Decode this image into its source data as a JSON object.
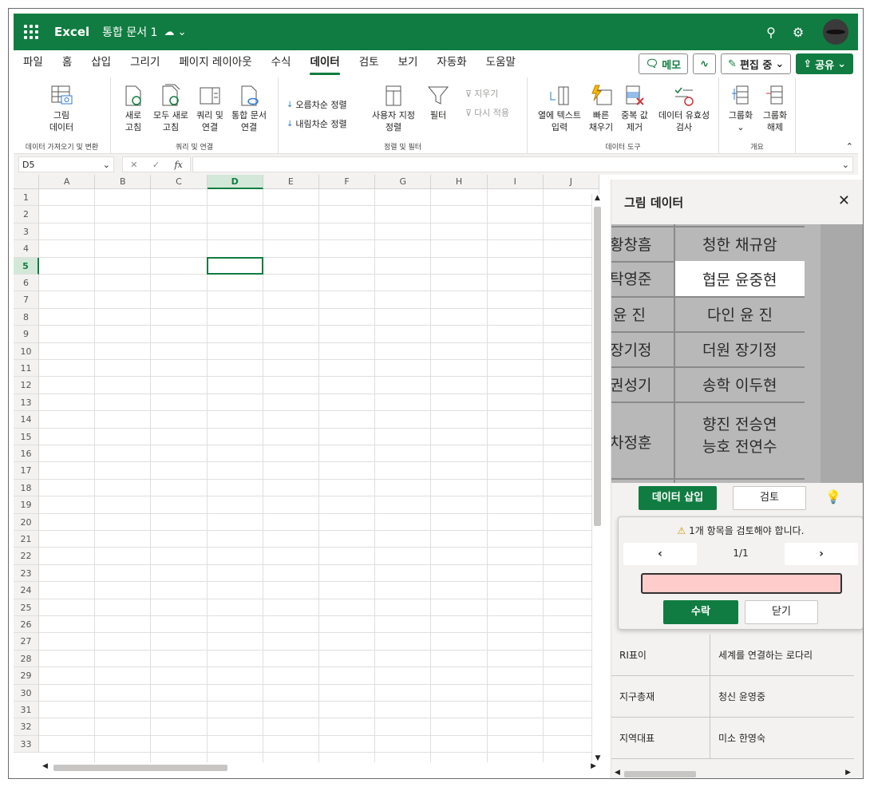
{
  "titlebar": {
    "app": "Excel",
    "doc": "통합 문서 1",
    "doc_status_icon": "cloud-save-icon"
  },
  "menu": {
    "tabs": [
      "파일",
      "홈",
      "삽입",
      "그리기",
      "페이지 레이아웃",
      "수식",
      "데이터",
      "검토",
      "보기",
      "자동화",
      "도움말"
    ],
    "active": "데이터",
    "memo": "메모",
    "editing": "편집 중",
    "share": "공유"
  },
  "ribbon": {
    "picture_data": "그림\n데이터",
    "refresh": "새로\n고침",
    "refresh_all": "모두 새로\n고침",
    "queries": "쿼리 및\n연결",
    "workbook_links": "통합 문서\n연결",
    "sort_asc": "오름차순 정렬",
    "sort_desc": "내림차순 정렬",
    "custom_sort": "사용자 지정\n정렬",
    "filter": "필터",
    "clear": "지우기",
    "reapply": "다시 적용",
    "text_to_cols": "열에 텍스트\n입력",
    "flash_fill": "빠른\n채우기",
    "remove_dup": "중복 값\n제거",
    "validation": "데이터 유효성\n검사",
    "group": "그룹화",
    "ungroup": "그룹화\n해제",
    "groups": {
      "get_data": "데이터 가져오기 및 변환",
      "queries": "쿼리 및 연결",
      "sort_filter": "정렬 및 필터",
      "data_tools": "데이터 도구",
      "outline": "개요"
    }
  },
  "formula": {
    "namebox": "D5",
    "fx": "fx"
  },
  "grid": {
    "columns": [
      "A",
      "B",
      "C",
      "D",
      "E",
      "F",
      "G",
      "H",
      "I",
      "J"
    ],
    "rows": [
      "1",
      "2",
      "3",
      "4",
      "5",
      "6",
      "7",
      "8",
      "9",
      "10",
      "11",
      "12",
      "13",
      "14",
      "15",
      "16",
      "17",
      "18",
      "19",
      "20",
      "21",
      "22",
      "23",
      "24",
      "25",
      "26",
      "27",
      "28",
      "29",
      "30",
      "31",
      "32",
      "33"
    ],
    "selected_col": "D",
    "selected_row": "5"
  },
  "pane": {
    "title": "그림 데이터",
    "preview_left": [
      "황창흠",
      "탁영준",
      "윤 진",
      "장기정",
      "권성기",
      "차정훈"
    ],
    "preview_right": [
      "청한 채규암",
      "협문 윤중현",
      "다인 윤 진",
      "더원 장기정",
      "송학 이두현",
      "향진 전승연",
      "능호 전연수"
    ],
    "insert": "데이터 삽입",
    "review": "검토",
    "warning": "1개 항목을 검토해야 합니다.",
    "counter": "1/1",
    "accept": "수락",
    "close": "닫기",
    "table": [
      {
        "a": "RI표이",
        "b": "세계를 연결하는 로다리"
      },
      {
        "a": "지구총재",
        "b": "청신 윤영중"
      },
      {
        "a": "지역대표",
        "b": "미소 한영숙"
      }
    ]
  }
}
